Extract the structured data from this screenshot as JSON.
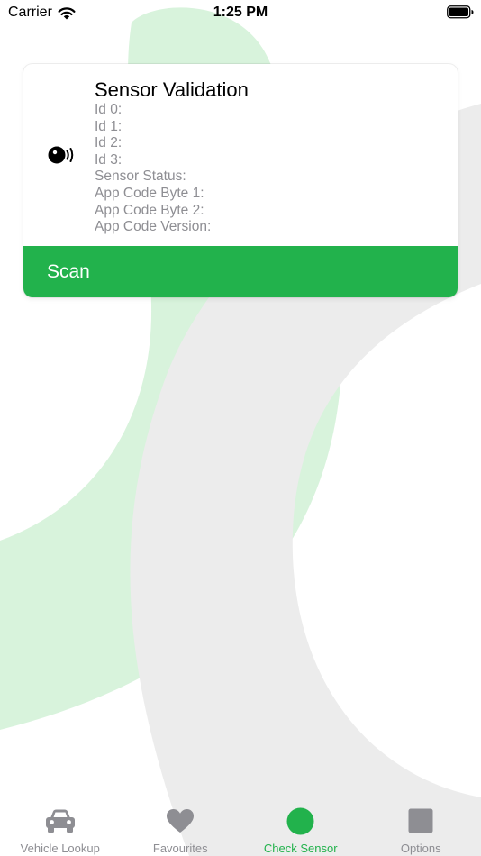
{
  "status_bar": {
    "carrier": "Carrier",
    "time": "1:25 PM"
  },
  "colors": {
    "accent": "#22b24c",
    "inactive": "#8e8e93",
    "decor_green": "#d8f3dc",
    "decor_gray": "#ececec"
  },
  "card": {
    "title": "Sensor Validation",
    "icon": "sensor-signal-icon",
    "fields": [
      "Id 0:",
      "Id 1:",
      "Id 2:",
      "Id 3:",
      "Sensor Status:",
      "App Code Byte 1:",
      "App Code Byte 2:",
      "App Code Version:"
    ],
    "scan_label": "Scan"
  },
  "tab_bar": {
    "tabs": [
      {
        "label": "Vehicle Lookup",
        "icon": "car-icon",
        "active": false
      },
      {
        "label": "Favourites",
        "icon": "heart-icon",
        "active": false
      },
      {
        "label": "Check Sensor",
        "icon": "circle-icon",
        "active": true
      },
      {
        "label": "Options",
        "icon": "square-icon",
        "active": false
      }
    ]
  }
}
